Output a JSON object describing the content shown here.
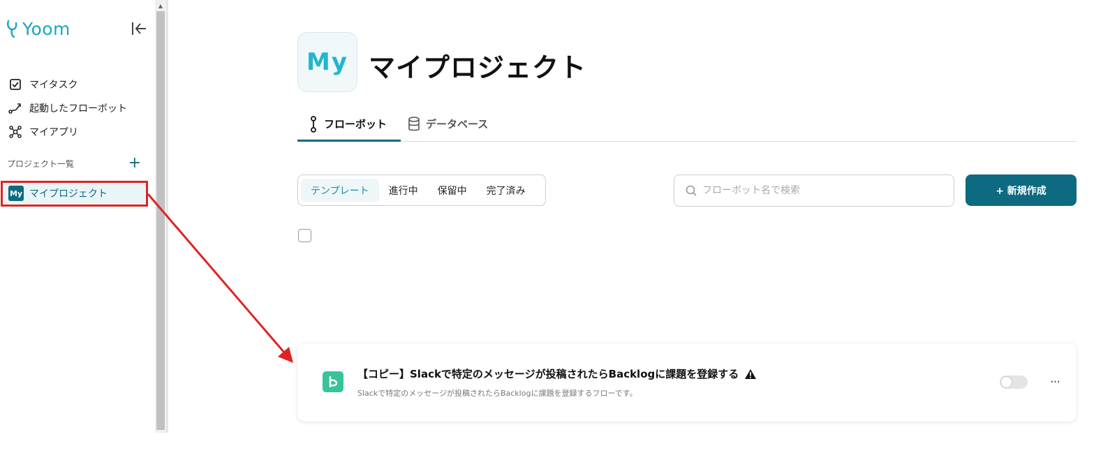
{
  "app": {
    "logo_text": "Yoom"
  },
  "sidebar": {
    "nav_items": [
      {
        "label": "マイタスク",
        "icon": "task-check-icon"
      },
      {
        "label": "起動したフローボット",
        "icon": "flow-route-icon"
      },
      {
        "label": "マイアプリ",
        "icon": "apps-network-icon"
      }
    ],
    "projects_title": "プロジェクト一覧",
    "add_project_label": "+",
    "project_item": {
      "avatar": "My",
      "label": "マイプロジェクト"
    }
  },
  "header": {
    "avatar": "My",
    "title": "マイプロジェクト"
  },
  "tabs": [
    {
      "label": "フローボット",
      "icon": "flowbot-icon",
      "active": true
    },
    {
      "label": "データベース",
      "icon": "database-icon",
      "active": false
    }
  ],
  "filters": [
    {
      "label": "テンプレート",
      "active": true
    },
    {
      "label": "進行中",
      "active": false
    },
    {
      "label": "保留中",
      "active": false
    },
    {
      "label": "完了済み",
      "active": false
    }
  ],
  "search": {
    "placeholder": "フローボット名で検索",
    "value": ""
  },
  "new_button": {
    "label": "+ 新規作成"
  },
  "flow_card": {
    "title": "【コピー】Slackで特定のメッセージが投稿されたらBacklogに課題を登録する",
    "description": "Slackで特定のメッセージが投稿されたらBacklogに課題を登録するフローです。",
    "enabled": false,
    "more_label": "···"
  },
  "colors": {
    "brand": "#0e6a80",
    "accent": "#1aa6c2",
    "annotation": "#e02222",
    "flow_icon": "#38c49a"
  }
}
